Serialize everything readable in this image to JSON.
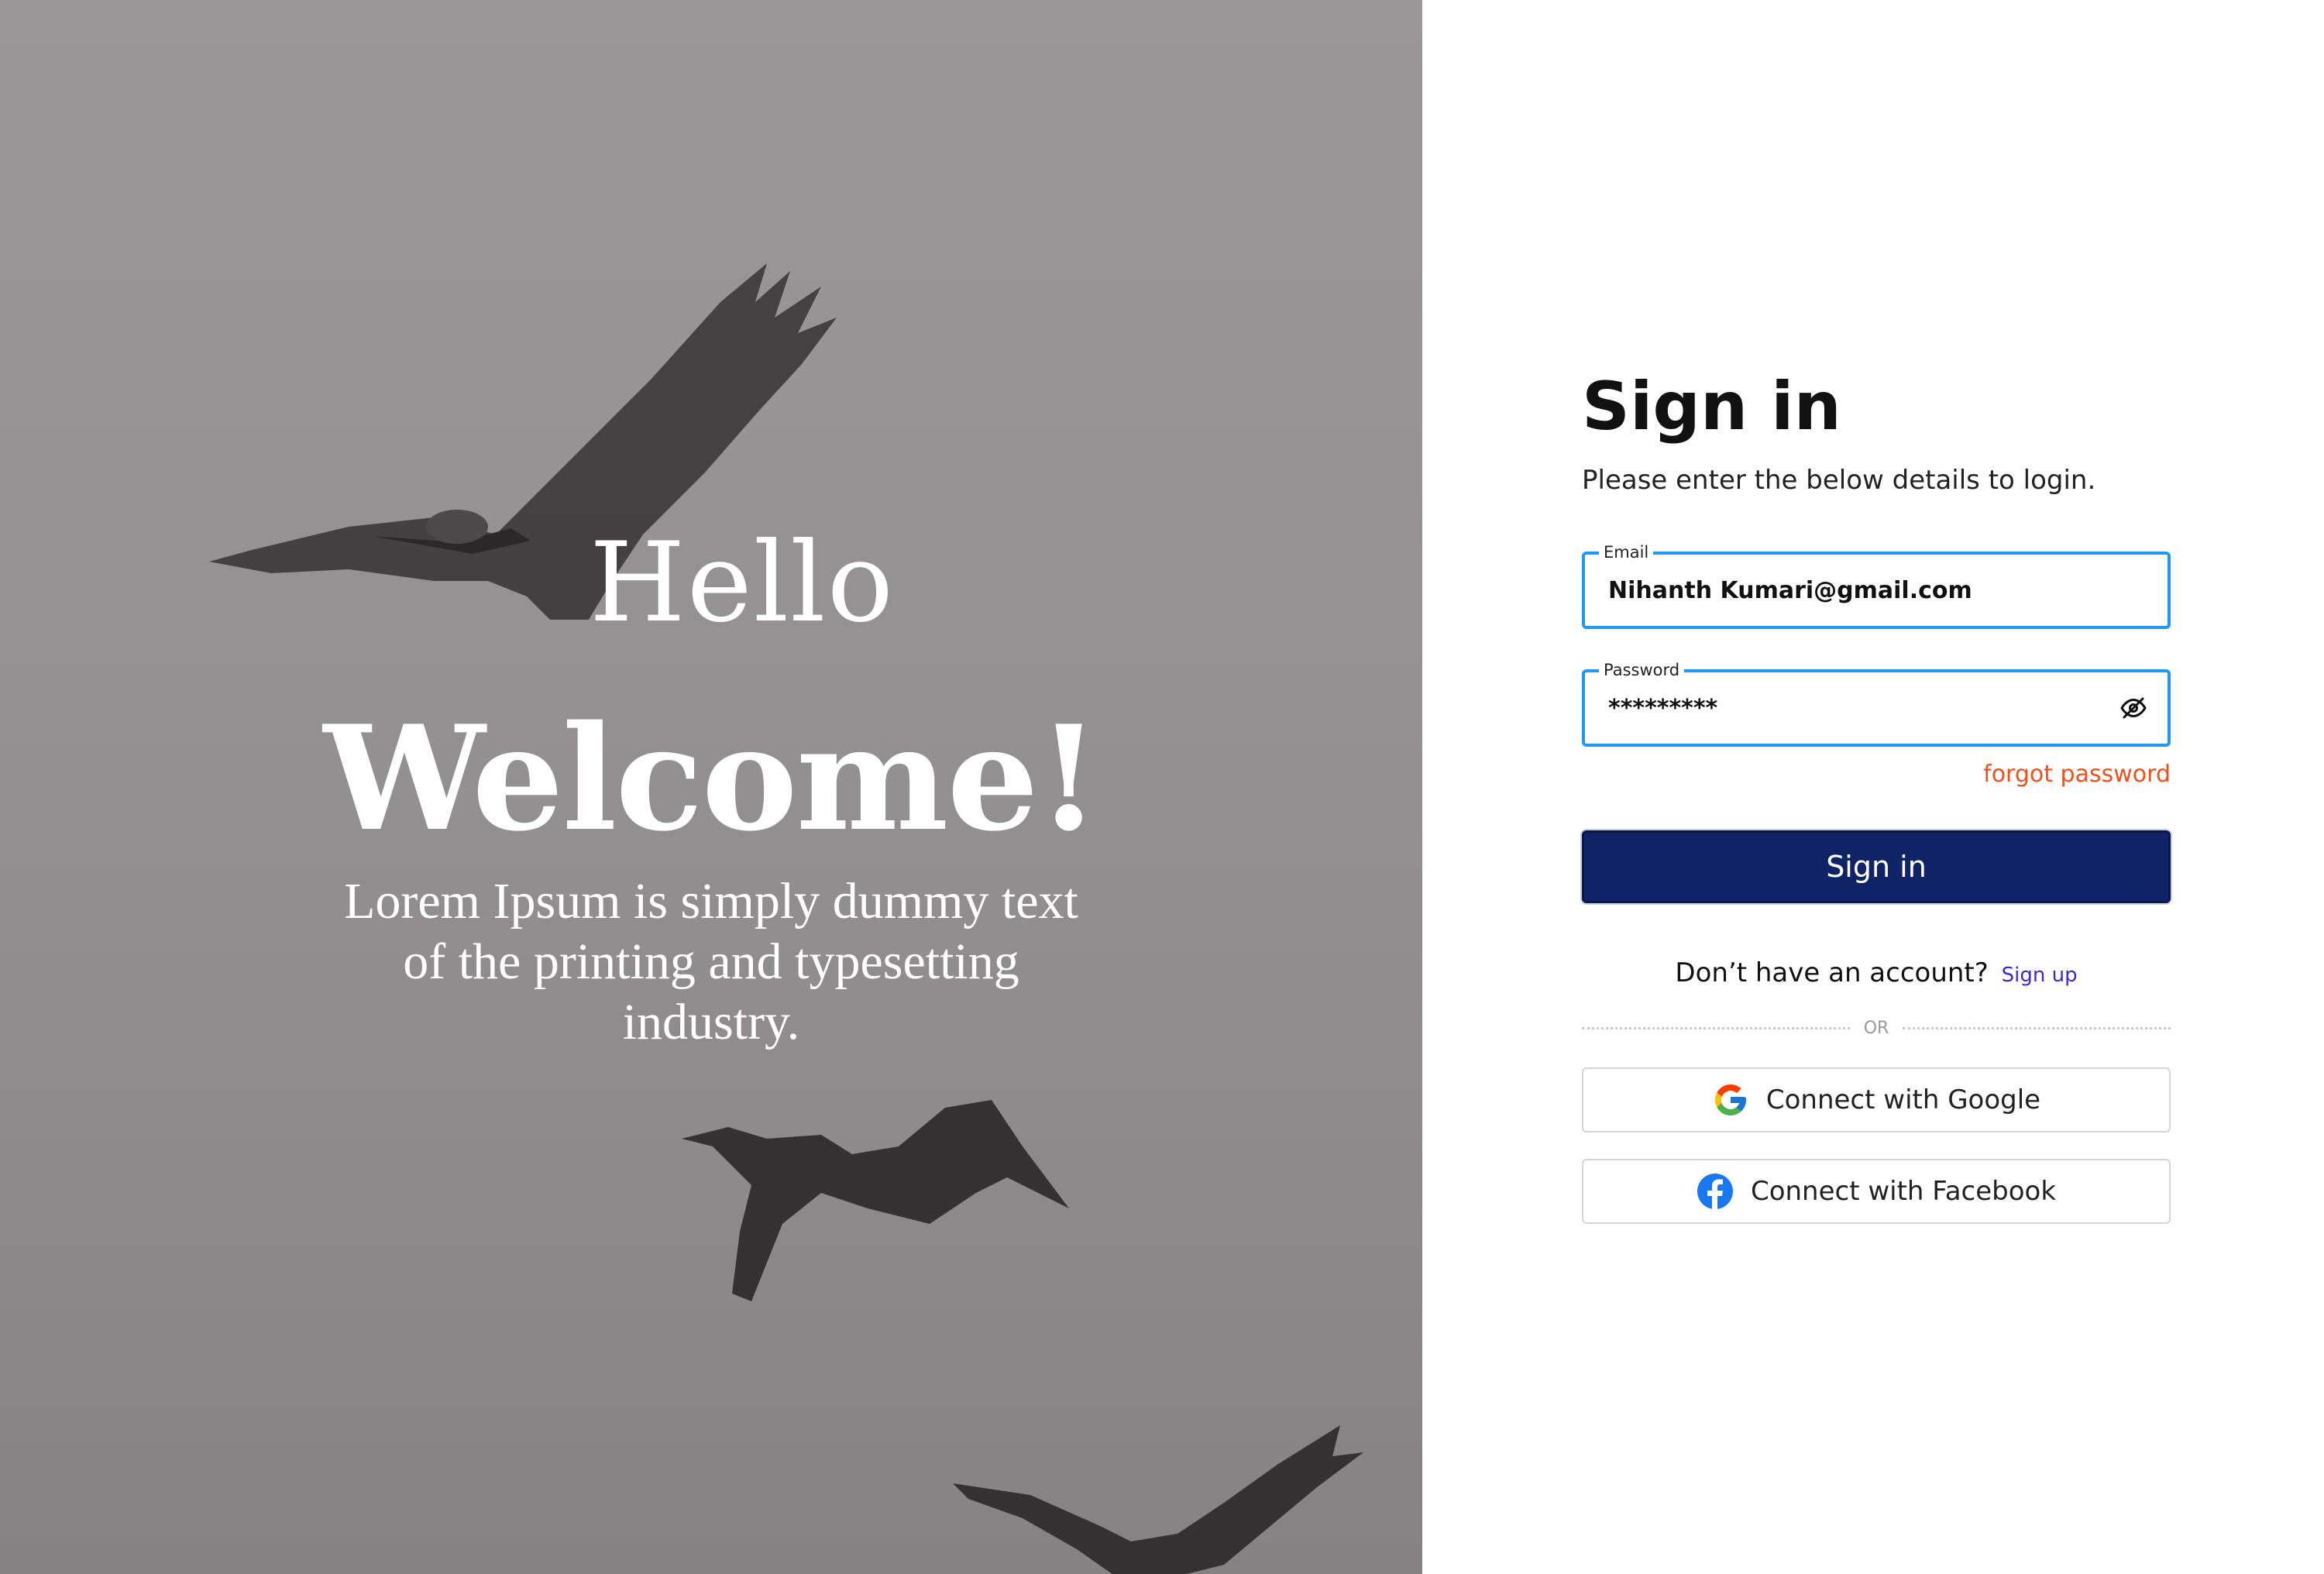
{
  "hero": {
    "hello": "Hello",
    "welcome": "Welcome!",
    "tagline": "Lorem Ipsum is simply dummy text of the printing and typesetting industry."
  },
  "form": {
    "title": "Sign in",
    "subtitle": "Please enter the below details to login.",
    "email": {
      "label": "Email",
      "value": "Nihanth Kumari@gmail.com"
    },
    "password": {
      "label": "Password",
      "value": "*********",
      "toggle_icon": "eye-slash-icon"
    },
    "forgot_label": "forgot password",
    "submit_label": "Sign in",
    "signup_prompt": "Don’t have an account?",
    "signup_link": "Sign up",
    "or_label": "OR",
    "google_label": "Connect with Google",
    "facebook_label": "Connect with Facebook"
  },
  "colors": {
    "accent": "#2196f3",
    "primary_button": "#0f2366",
    "forgot_link": "#f0501c",
    "signup_link": "#3a2bd1",
    "facebook": "#1877f2"
  }
}
